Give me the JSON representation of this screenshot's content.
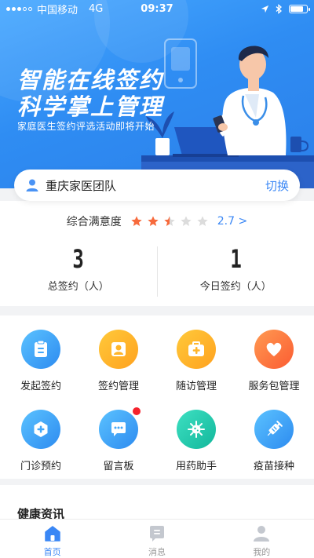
{
  "status_bar": {
    "carrier": "中国移动",
    "network": "4G",
    "time": "09:37"
  },
  "hero": {
    "title_line1": "智能在线签约",
    "title_line2": "科学掌上管理",
    "subtitle": "家庭医生签约评选活动即将开始"
  },
  "team": {
    "name": "重庆家医团队",
    "switch_label": "切换"
  },
  "rating": {
    "label": "综合满意度",
    "stars": 2.5,
    "max_stars": 5,
    "value_text": "2.7 >"
  },
  "counts": {
    "total": {
      "value": "3",
      "label": "总签约（人）"
    },
    "today": {
      "value": "1",
      "label": "今日签约（人）"
    }
  },
  "features": [
    {
      "label": "发起签约",
      "icon": "clipboard-icon",
      "color": "blue"
    },
    {
      "label": "签约管理",
      "icon": "user-check-icon",
      "color": "orange"
    },
    {
      "label": "随访管理",
      "icon": "medical-kit-icon",
      "color": "orange"
    },
    {
      "label": "服务包管理",
      "icon": "heart-icon",
      "color": "red"
    },
    {
      "label": "门诊预约",
      "icon": "plus-hexagon-icon",
      "color": "blue"
    },
    {
      "label": "留言板",
      "icon": "chat-bubble-icon",
      "color": "blue",
      "badge": true
    },
    {
      "label": "用药助手",
      "icon": "virus-icon",
      "color": "teal"
    },
    {
      "label": "疫苗接种",
      "icon": "syringe-icon",
      "color": "blue"
    }
  ],
  "news": {
    "title": "健康资讯"
  },
  "tabs": [
    {
      "label": "首页",
      "active": true
    },
    {
      "label": "消息",
      "active": false
    },
    {
      "label": "我的",
      "active": false
    }
  ],
  "colors": {
    "primary": "#3a87f5",
    "star_active": "#f76a3c",
    "star_inactive": "#dcdcdc",
    "badge": "#f5222d"
  }
}
